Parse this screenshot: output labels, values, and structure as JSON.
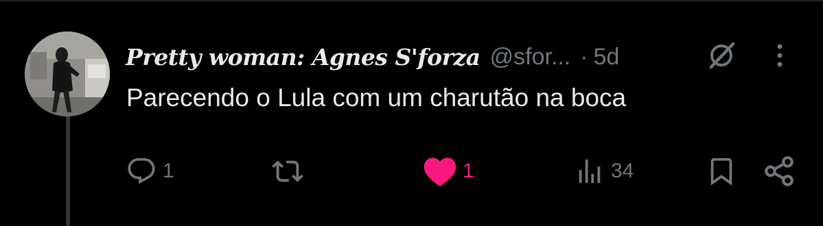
{
  "tweet": {
    "display_name": "Pretty woman: Agnes S'forza",
    "handle": "@sfor...",
    "separator": "·",
    "time": "5d",
    "text": "Parecendo o Lula com um charutão na boca"
  },
  "actions": {
    "reply_count": "1",
    "retweet_count": "",
    "like_count": "1",
    "views_count": "34"
  },
  "icons": {
    "reply": "reply-icon",
    "retweet": "retweet-icon",
    "like": "heart-filled-icon",
    "views": "views-icon",
    "bookmark": "bookmark-icon",
    "share": "share-icon",
    "grok": "grok-icon",
    "more": "more-vertical-icon"
  },
  "colors": {
    "background": "#000000",
    "text_primary": "#e7e9ea",
    "text_secondary": "#71767b",
    "like_active": "#f91880",
    "thread_line": "#333639"
  }
}
